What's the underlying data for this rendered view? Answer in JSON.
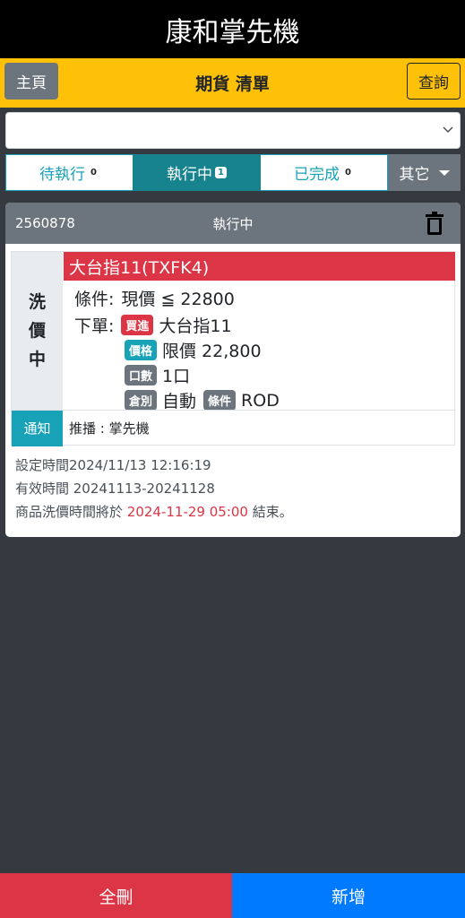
{
  "app": {
    "title": "康和掌先機"
  },
  "header": {
    "home": "主頁",
    "title": "期貨 清單",
    "query": "查詢"
  },
  "select": {
    "value": ""
  },
  "tabs": [
    {
      "label": "待執行",
      "count": "0"
    },
    {
      "label": "執行中",
      "count": "1"
    },
    {
      "label": "已完成",
      "count": "0"
    },
    {
      "label": "其它"
    }
  ],
  "card": {
    "order_id": "2560878",
    "status": "執行中",
    "side_label": [
      "洗",
      "價",
      "中"
    ],
    "product": "大台指11(TXFK4)",
    "condition_label": "條件:",
    "condition_value": "現價 ≦ 22800",
    "order_label": "下單:",
    "buy_tag": "買進",
    "order_product": "大台指11",
    "price_tag": "價格",
    "price_value": "限價 22,800",
    "qty_tag": "口數",
    "qty_value": "1口",
    "pos_tag": "倉別",
    "pos_value": "自動",
    "cond_tag": "條件",
    "cond_value": "ROD",
    "notice_label": "通知",
    "notice_text": "推播 : 掌先機",
    "set_time": "設定時間2024/11/13 12:16:19",
    "valid_time": "有效時間 20241113-20241128",
    "end_prefix": "商品洗價時間將於",
    "end_time": "2024-11-29 05:00",
    "end_suffix": "結束。"
  },
  "bottom": {
    "delete_all": "全刪",
    "add": "新增"
  },
  "colors": {
    "accent": "#ffc107",
    "teal": "#17a2b8",
    "red": "#dc3545",
    "blue": "#007bff"
  }
}
